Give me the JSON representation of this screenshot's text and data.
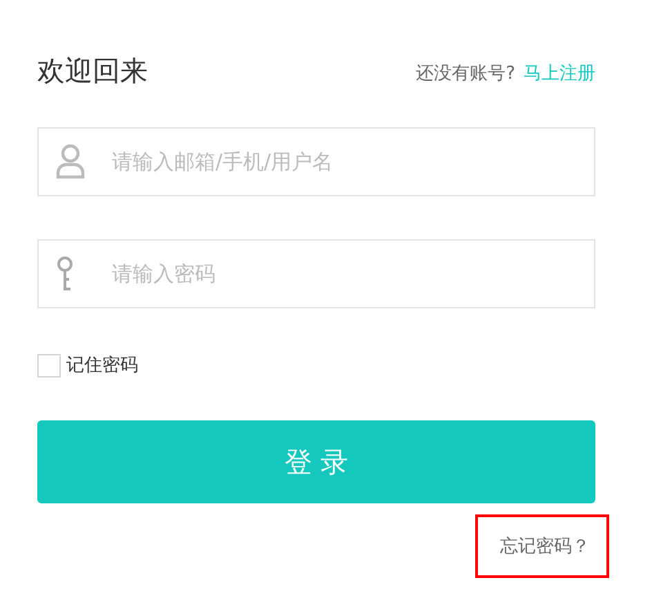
{
  "title": "欢迎回来",
  "signup": {
    "prompt": "还没有账号?",
    "link": "马上注册"
  },
  "fields": [
    {
      "kind": "user",
      "placeholder": "请输入邮箱/手机/用户名"
    },
    {
      "kind": "key",
      "placeholder": "请输入密码"
    }
  ],
  "remember": {
    "label": "记住密码",
    "checked": false
  },
  "login_button": "登 录",
  "forgot": {
    "label": "忘记密码？",
    "highlighted": true
  }
}
